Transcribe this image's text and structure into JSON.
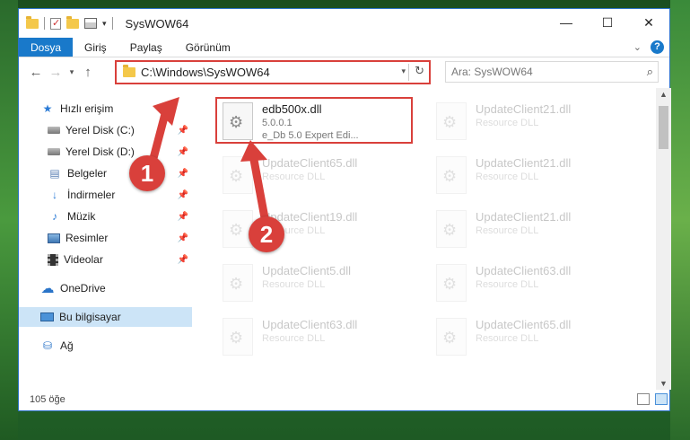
{
  "window": {
    "title": "SysWOW64",
    "controls": {
      "minimize": "—",
      "maximize": "☐",
      "close": "✕"
    }
  },
  "ribbon": {
    "tabs": [
      "Dosya",
      "Giriş",
      "Paylaş",
      "Görünüm"
    ],
    "active_tab": "Dosya",
    "help_label": "?"
  },
  "address": {
    "path": "C:\\Windows\\SysWOW64",
    "refresh": "↻"
  },
  "search": {
    "placeholder": "Ara: SysWOW64"
  },
  "sidebar": {
    "items": [
      {
        "label": "Hızlı erişim",
        "icon": "star-icon",
        "pinned": false
      },
      {
        "label": "Yerel Disk (C:)",
        "icon": "disk-icon",
        "pinned": true
      },
      {
        "label": "Yerel Disk (D:)",
        "icon": "disk-icon",
        "pinned": true
      },
      {
        "label": "Belgeler",
        "icon": "document-icon",
        "pinned": true
      },
      {
        "label": "İndirmeler",
        "icon": "download-icon",
        "pinned": true
      },
      {
        "label": "Müzik",
        "icon": "music-icon",
        "pinned": true
      },
      {
        "label": "Resimler",
        "icon": "pictures-icon",
        "pinned": true
      },
      {
        "label": "Videolar",
        "icon": "videos-icon",
        "pinned": true
      },
      {
        "label": "OneDrive",
        "icon": "cloud-icon",
        "pinned": false
      },
      {
        "label": "Bu bilgisayar",
        "icon": "computer-icon",
        "pinned": false,
        "selected": true
      },
      {
        "label": "Ağ",
        "icon": "network-icon",
        "pinned": false
      }
    ]
  },
  "files": [
    {
      "name": "edb500x.dll",
      "line2": "5.0.0.1",
      "line3": "e_Db 5.0 Expert Edi...",
      "highlighted": true
    },
    {
      "name": "UpdateClient21.dll",
      "line2": "Resource DLL"
    },
    {
      "name": "UpdateClient65.dll",
      "line2": "Resource DLL"
    },
    {
      "name": "UpdateClient21.dll",
      "line2": "Resource DLL"
    },
    {
      "name": "UpdateClient19.dll",
      "line2": "Resource DLL"
    },
    {
      "name": "UpdateClient21.dll",
      "line2": "Resource DLL"
    },
    {
      "name": "UpdateClient5.dll",
      "line2": "Resource DLL"
    },
    {
      "name": "UpdateClient63.dll",
      "line2": "Resource DLL"
    },
    {
      "name": "UpdateClient63.dll",
      "line2": "Resource DLL"
    },
    {
      "name": "UpdateClient65.dll",
      "line2": "Resource DLL"
    }
  ],
  "status": {
    "item_count": "105 öğe"
  },
  "callouts": [
    "1",
    "2"
  ],
  "colors": {
    "accent": "#1979ca",
    "highlight": "#d9403b",
    "selected": "#cce4f7"
  }
}
